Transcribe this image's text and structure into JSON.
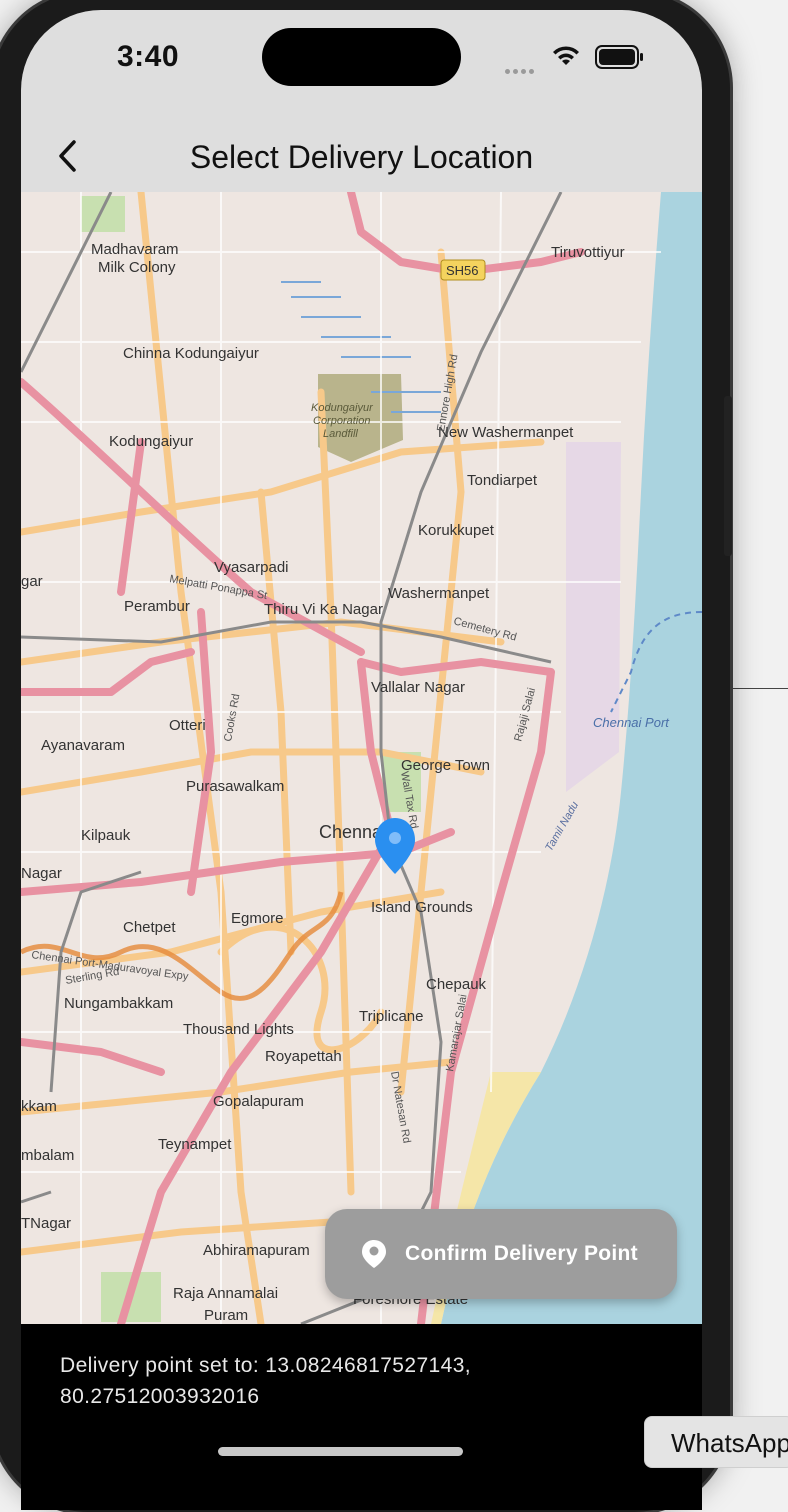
{
  "status_bar": {
    "time": "3:40"
  },
  "app_bar": {
    "title": "Select Delivery Location"
  },
  "map": {
    "place_labels": [
      "Madhavaram\nMilk Colony",
      "SH56",
      "Tiruvottiyur",
      "Chinna Kodungaiyur",
      "Kodungaiyur",
      "Kodungaiyur Corporation Landfill",
      "New Washermanpet",
      "Tondiarpet",
      "Korukkupet",
      "Vyasarpadi",
      "Washermanpet",
      "Perambur",
      "Thiru Vi Ka Nagar",
      "Vallalar Nagar",
      "Otteri",
      "Ayanavaram",
      "Chennai Port",
      "George Town",
      "Purasawalkam",
      "Chennai",
      "Kilpauk",
      "Nagar",
      "Island Grounds",
      "Chetpet",
      "Egmore",
      "Chepauk",
      "Nungambakkam",
      "Thousand Lights",
      "Triplicane",
      "Royapettah",
      "Gopalapuram",
      "Teynampet",
      "Abhiramapuram",
      "Raja Annamalai Puram",
      "Foreshore Estate",
      "Ennore High Rd",
      "Wall Tax Rd",
      "Rajaji Salai",
      "Tamil Nadu",
      "Cemetery Rd",
      "Cooks Rd",
      "Melpatti Ponappa St",
      "Kamarajar Salai",
      "Dr Natesan Rd",
      "Sterling Rd",
      "Chennai Port-Maduravoyal Expy",
      "gar",
      "kkam",
      "mbalam",
      "TNagar"
    ],
    "marker_icon": "map-pin-icon"
  },
  "confirm_button": {
    "label": "Confirm Delivery Point",
    "icon": "location-pin-icon"
  },
  "delivery_status": {
    "text": "Delivery point set to: 13.08246817527143, 80.27512003932016"
  },
  "desktop": {
    "tooltip": "WhatsApp"
  },
  "colors": {
    "map_land": "#efe9df",
    "map_sea": "#aad3df",
    "major_road": "#e892a2",
    "secondary_road": "#fcd6a4",
    "marker": "#2a8ff0",
    "button_bg": "#9d9d9d",
    "app_bar_bg": "#dedede"
  }
}
